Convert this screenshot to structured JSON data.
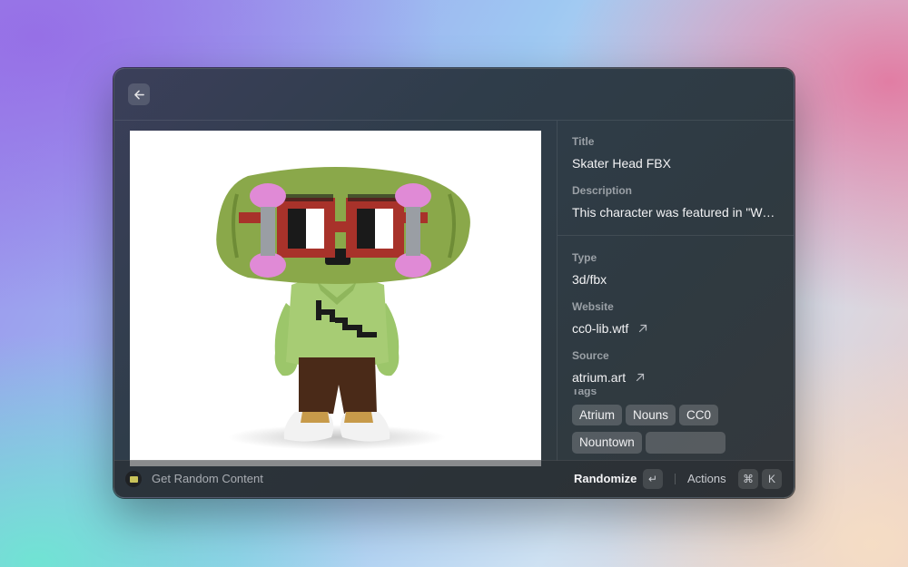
{
  "footer": {
    "command_title": "Get Random Content",
    "primary_action": "Randomize",
    "primary_shortcut": "↵",
    "actions_label": "Actions",
    "actions_shortcut_mod": "⌘",
    "actions_shortcut_key": "K"
  },
  "detail": {
    "title_label": "Title",
    "title_value": "Skater Head FBX",
    "description_label": "Description",
    "description_value": "This character was featured in \"We…",
    "type_label": "Type",
    "type_value": "3d/fbx",
    "website_label": "Website",
    "website_value": "cc0-lib.wtf",
    "source_label": "Source",
    "source_value": "atrium.art",
    "tags_label": "Tags",
    "tags": [
      "Atrium",
      "Nouns",
      "CC0",
      "Nountown"
    ]
  },
  "colors": {
    "skateboard_green": "#8aa84a",
    "wheel_pink": "#e08ad6",
    "glasses_red": "#a8322a",
    "shirt_green": "#9cc66a"
  }
}
